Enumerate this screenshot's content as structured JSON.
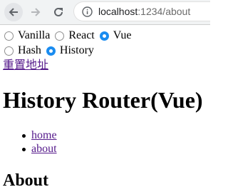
{
  "browser": {
    "url_host": "localhost",
    "url_rest": ":1234/about"
  },
  "framework_options": [
    {
      "label": "Vanilla",
      "checked": false
    },
    {
      "label": "React",
      "checked": false
    },
    {
      "label": "Vue",
      "checked": true
    }
  ],
  "router_mode_options": [
    {
      "label": "Hash",
      "checked": false
    },
    {
      "label": "History",
      "checked": true
    }
  ],
  "reset_link": "重置地址",
  "title": "History Router(Vue)",
  "nav_links": [
    "home",
    "about"
  ],
  "section_title": "About",
  "colors": {
    "accent": "#1a8cf0",
    "link": "#551a8b"
  }
}
